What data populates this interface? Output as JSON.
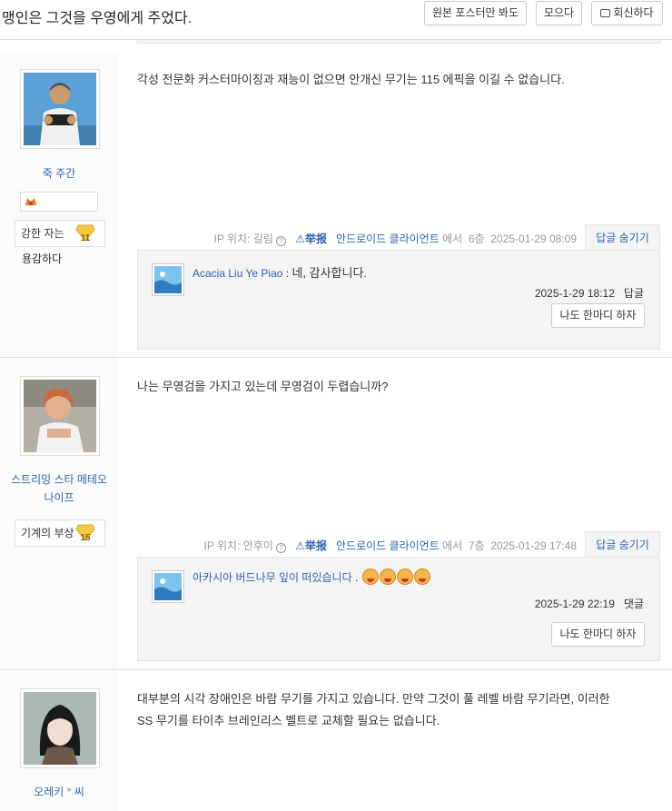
{
  "topbar": {
    "title": "맹인은 그것을 우영에게 주었다.",
    "btn_original": "원본 포스터만 봐도",
    "btn_collect": "모으다",
    "btn_reply": "회신하다"
  },
  "posts": [
    {
      "username": "죽 주간",
      "badge": "강한 자는",
      "level": "11",
      "badge_sub": "용감하다",
      "content": "각성 전문화 커스터마이징과 재능이 없으면 안개신 무기는 115 에픽을 이길 수 없습니다.",
      "ip_label": "IP 위치: 길림",
      "report": "举报",
      "client": "안드로이드 클라이언트",
      "from": "에서",
      "floor": "6층",
      "time": "2025-01-29 08:09",
      "hide": "답글 숨기기",
      "reply": {
        "name": "Acacia Liu Ye Piao",
        "text": "네, 감사합니다.",
        "time": "2025-1-29 18:12",
        "action": "답글",
        "btn": "나도 한마디 하자"
      }
    },
    {
      "username": "스트리밍 스타 메테오 나이프",
      "badge": "기계의 부상",
      "level": "15",
      "content": "나는 무영검을 가지고 있는데 무영검이 두렵습니까?",
      "ip_label": "IP 위치: 안후이",
      "report": "举报",
      "client": "안드로이드 클라이언트",
      "from": "에서",
      "floor": "7층",
      "time": "2025-01-29 17:48",
      "hide": "답글 숨기기",
      "reply": {
        "name": "아카시아 버드나무 잎이 떠있습니다",
        "text": ".",
        "time": "2025-1-29 22:19",
        "action": "댓글",
        "btn": "나도 한마디 하자"
      }
    },
    {
      "username": "오레키 ° 씨",
      "content_line1": "대부분의 시각 장애인은 바람 무기를 가지고 있습니다. 만약 그것이 풀 레벨 바람 무기라면, 이러한",
      "content_line2": "SS 무기를 타이추 브레인리스 벨트로 교체할 필요는 없습니다."
    }
  ],
  "colors": {
    "link": "#2d64b3",
    "sidebar": "#fbfbfb",
    "replybox": "#f4f4f4",
    "level_badge": "#f5c842"
  },
  "icons": [
    "reply-icon",
    "question-icon",
    "warning-icon",
    "laugh-emoji",
    "medal-icon"
  ]
}
